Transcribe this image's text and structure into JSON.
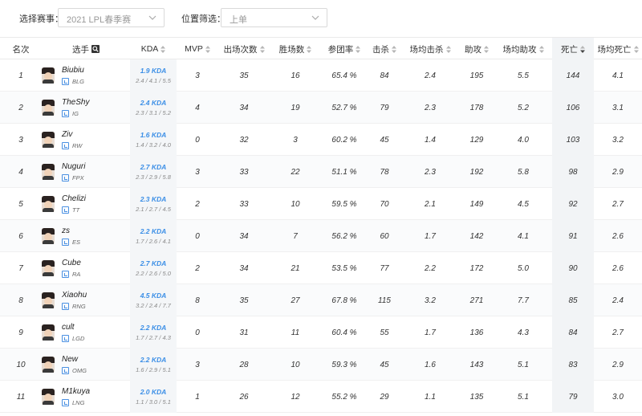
{
  "filters": {
    "event_label": "选择赛事：",
    "event_value": "2021 LPL春季赛",
    "position_label": "位置筛选：",
    "position_value": "上单"
  },
  "columns": [
    {
      "key": "rank",
      "label": "名次",
      "sortable": false
    },
    {
      "key": "player",
      "label": "选手",
      "sortable": false,
      "search": true
    },
    {
      "key": "kda",
      "label": "KDA",
      "sortable": true
    },
    {
      "key": "mvp",
      "label": "MVP",
      "sortable": true
    },
    {
      "key": "games",
      "label": "出场次数",
      "sortable": true
    },
    {
      "key": "wins",
      "label": "胜场数",
      "sortable": true
    },
    {
      "key": "kp",
      "label": "参团率",
      "sortable": true
    },
    {
      "key": "kills",
      "label": "击杀",
      "sortable": true
    },
    {
      "key": "avg_kills",
      "label": "场均击杀",
      "sortable": true
    },
    {
      "key": "assists",
      "label": "助攻",
      "sortable": true
    },
    {
      "key": "avg_assists",
      "label": "场均助攻",
      "sortable": true
    },
    {
      "key": "deaths",
      "label": "死亡",
      "sortable": true,
      "sorted": "desc"
    },
    {
      "key": "avg_deaths",
      "label": "场均死亡",
      "sortable": true
    }
  ],
  "rows": [
    {
      "rank": "1",
      "name": "Biubiu",
      "team": "BLG",
      "kda": "1.9 KDA",
      "kda_detail": "2.4 / 4.1 / 5.5",
      "mvp": "3",
      "games": "35",
      "wins": "16",
      "kp": "65.4 %",
      "kills": "84",
      "avg_kills": "2.4",
      "assists": "195",
      "avg_assists": "5.5",
      "deaths": "144",
      "avg_deaths": "4.1"
    },
    {
      "rank": "2",
      "name": "TheShy",
      "team": "IG",
      "kda": "2.4 KDA",
      "kda_detail": "2.3 / 3.1 / 5.2",
      "mvp": "4",
      "games": "34",
      "wins": "19",
      "kp": "52.7 %",
      "kills": "79",
      "avg_kills": "2.3",
      "assists": "178",
      "avg_assists": "5.2",
      "deaths": "106",
      "avg_deaths": "3.1"
    },
    {
      "rank": "3",
      "name": "Ziv",
      "team": "RW",
      "kda": "1.6 KDA",
      "kda_detail": "1.4 / 3.2 / 4.0",
      "mvp": "0",
      "games": "32",
      "wins": "3",
      "kp": "60.2 %",
      "kills": "45",
      "avg_kills": "1.4",
      "assists": "129",
      "avg_assists": "4.0",
      "deaths": "103",
      "avg_deaths": "3.2"
    },
    {
      "rank": "4",
      "name": "Nuguri",
      "team": "FPX",
      "kda": "2.7 KDA",
      "kda_detail": "2.3 / 2.9 / 5.8",
      "mvp": "3",
      "games": "33",
      "wins": "22",
      "kp": "51.1 %",
      "kills": "78",
      "avg_kills": "2.3",
      "assists": "192",
      "avg_assists": "5.8",
      "deaths": "98",
      "avg_deaths": "2.9"
    },
    {
      "rank": "5",
      "name": "Chelizi",
      "team": "TT",
      "kda": "2.3 KDA",
      "kda_detail": "2.1 / 2.7 / 4.5",
      "mvp": "2",
      "games": "33",
      "wins": "10",
      "kp": "59.5 %",
      "kills": "70",
      "avg_kills": "2.1",
      "assists": "149",
      "avg_assists": "4.5",
      "deaths": "92",
      "avg_deaths": "2.7"
    },
    {
      "rank": "6",
      "name": "zs",
      "team": "ES",
      "kda": "2.2 KDA",
      "kda_detail": "1.7 / 2.6 / 4.1",
      "mvp": "0",
      "games": "34",
      "wins": "7",
      "kp": "56.2 %",
      "kills": "60",
      "avg_kills": "1.7",
      "assists": "142",
      "avg_assists": "4.1",
      "deaths": "91",
      "avg_deaths": "2.6"
    },
    {
      "rank": "7",
      "name": "Cube",
      "team": "RA",
      "kda": "2.7 KDA",
      "kda_detail": "2.2 / 2.6 / 5.0",
      "mvp": "2",
      "games": "34",
      "wins": "21",
      "kp": "53.5 %",
      "kills": "77",
      "avg_kills": "2.2",
      "assists": "172",
      "avg_assists": "5.0",
      "deaths": "90",
      "avg_deaths": "2.6"
    },
    {
      "rank": "8",
      "name": "Xiaohu",
      "team": "RNG",
      "kda": "4.5 KDA",
      "kda_detail": "3.2 / 2.4 / 7.7",
      "mvp": "8",
      "games": "35",
      "wins": "27",
      "kp": "67.8 %",
      "kills": "115",
      "avg_kills": "3.2",
      "assists": "271",
      "avg_assists": "7.7",
      "deaths": "85",
      "avg_deaths": "2.4"
    },
    {
      "rank": "9",
      "name": "cult",
      "team": "LGD",
      "kda": "2.2 KDA",
      "kda_detail": "1.7 / 2.7 / 4.3",
      "mvp": "0",
      "games": "31",
      "wins": "11",
      "kp": "60.4 %",
      "kills": "55",
      "avg_kills": "1.7",
      "assists": "136",
      "avg_assists": "4.3",
      "deaths": "84",
      "avg_deaths": "2.7"
    },
    {
      "rank": "10",
      "name": "New",
      "team": "OMG",
      "kda": "2.2 KDA",
      "kda_detail": "1.6 / 2.9 / 5.1",
      "mvp": "3",
      "games": "28",
      "wins": "10",
      "kp": "59.3 %",
      "kills": "45",
      "avg_kills": "1.6",
      "assists": "143",
      "avg_assists": "5.1",
      "deaths": "83",
      "avg_deaths": "2.9"
    },
    {
      "rank": "11",
      "name": "M1kuya",
      "team": "LNG",
      "kda": "2.0 KDA",
      "kda_detail": "1.1 / 3.0 / 5.1",
      "mvp": "1",
      "games": "26",
      "wins": "12",
      "kp": "55.2 %",
      "kills": "29",
      "avg_kills": "1.1",
      "assists": "135",
      "avg_assists": "5.1",
      "deaths": "79",
      "avg_deaths": "3.0"
    }
  ],
  "colors": {
    "accent": "#3a8ee6",
    "team_icon": "#4a90e2",
    "sorted_bg": "#f2f4f6"
  },
  "icons": {
    "search": "search-icon",
    "sort": "sort-icon",
    "chevron": "chevron-down-icon",
    "team": "team-icon"
  }
}
